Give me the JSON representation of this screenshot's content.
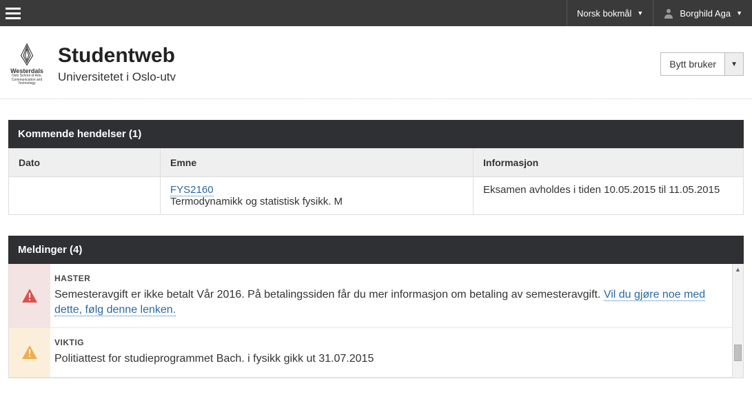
{
  "topbar": {
    "language": "Norsk bokmål",
    "user": "Borghild Aga"
  },
  "header": {
    "logo_name": "Westerdals",
    "logo_sub": "Oslo School of Arts, Communication and Technology",
    "title": "Studentweb",
    "subtitle": "Universitetet i Oslo-utv",
    "switch_user": "Bytt bruker"
  },
  "events": {
    "panel_title": "Kommende hendelser (1)",
    "columns": {
      "date": "Dato",
      "subject": "Emne",
      "info": "Informasjon"
    },
    "rows": [
      {
        "date": "",
        "course_code": "FYS2160",
        "course_name": "Termodynamikk og statistisk fysikk. M",
        "info": "Eksamen avholdes i tiden 10.05.2015 til 11.05.2015"
      }
    ]
  },
  "messages": {
    "panel_title": "Meldinger (4)",
    "items": [
      {
        "severity": "urgent",
        "label": "HASTER",
        "text": "Semesteravgift er ikke betalt Vår 2016. På betalingssiden får du mer informasjon om betaling av semesteravgift. ",
        "link_text": "Vil du gjøre noe med dette, følg denne lenken."
      },
      {
        "severity": "important",
        "label": "VIKTIG",
        "text": "Politiattest for studieprogrammet Bach. i fysikk gikk ut 31.07.2015",
        "link_text": ""
      }
    ]
  }
}
